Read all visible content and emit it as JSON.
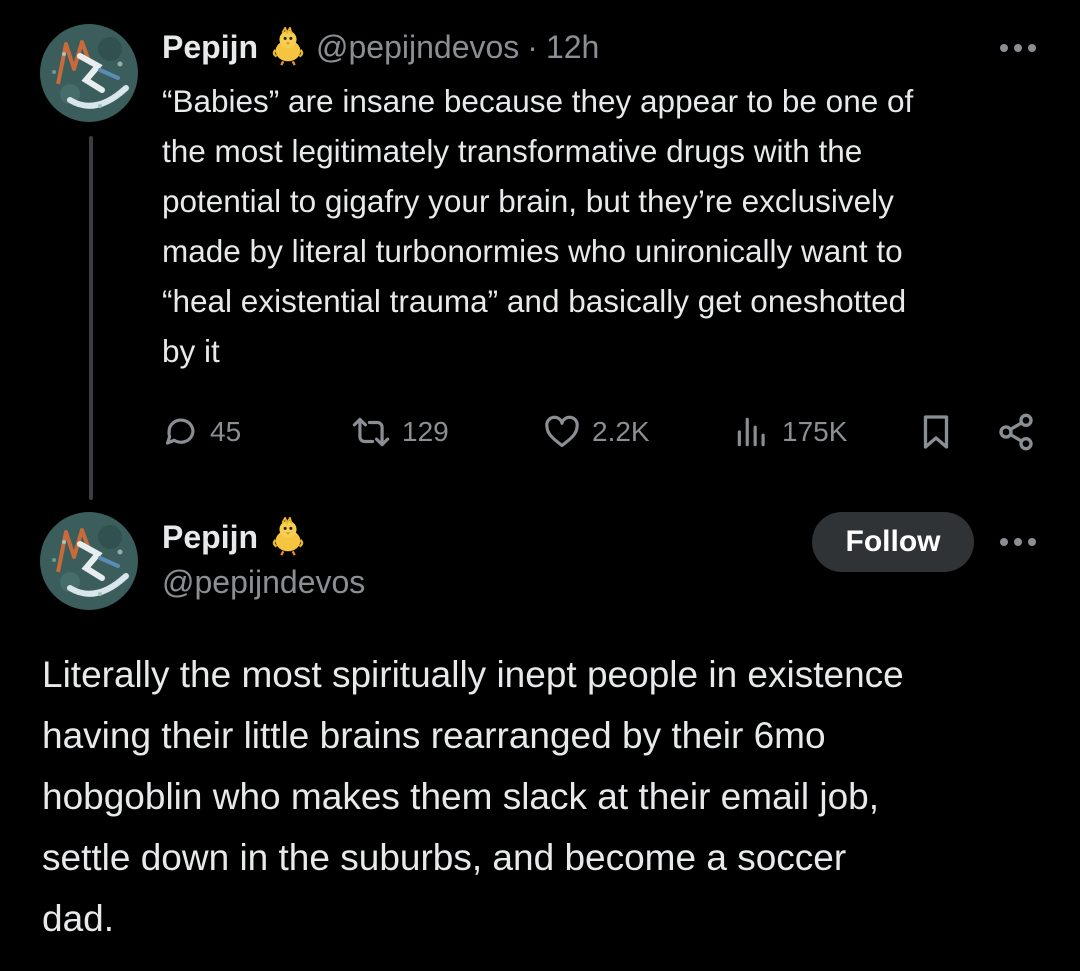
{
  "colors": {
    "background": "#000000",
    "text_primary": "#e7e9ea",
    "text_secondary": "#8b8f94",
    "follow_button_bg": "#2f3336",
    "thread_line": "#3a3d41"
  },
  "tweet1": {
    "author_name": "Pepijn",
    "badge_icon": "chick-emoji-icon",
    "handle": "@pepijndevos",
    "separator": "·",
    "time": "12h",
    "more_icon": "more-dots-icon",
    "text_lines": [
      "“Babies” are insane because they appear to be one of",
      "the most legitimately transformative drugs with the",
      "potential to gigafry your brain, but they’re exclusively",
      "made by literal turbonormies who unironically want to",
      "“heal existential trauma” and basically get oneshotted",
      "by it"
    ],
    "actions": {
      "replies": "45",
      "reposts": "129",
      "likes": "2.2K",
      "views": "175K"
    }
  },
  "tweet2": {
    "author_name": "Pepijn",
    "badge_icon": "chick-emoji-icon",
    "handle": "@pepijndevos",
    "follow_label": "Follow",
    "more_icon": "more-dots-icon",
    "text_lines": [
      "Literally the most spiritually inept people in existence",
      "having their little brains rearranged by their 6mo",
      "hobgoblin who makes them slack at their email job,",
      "settle down in the suburbs, and become a soccer",
      "dad."
    ]
  }
}
